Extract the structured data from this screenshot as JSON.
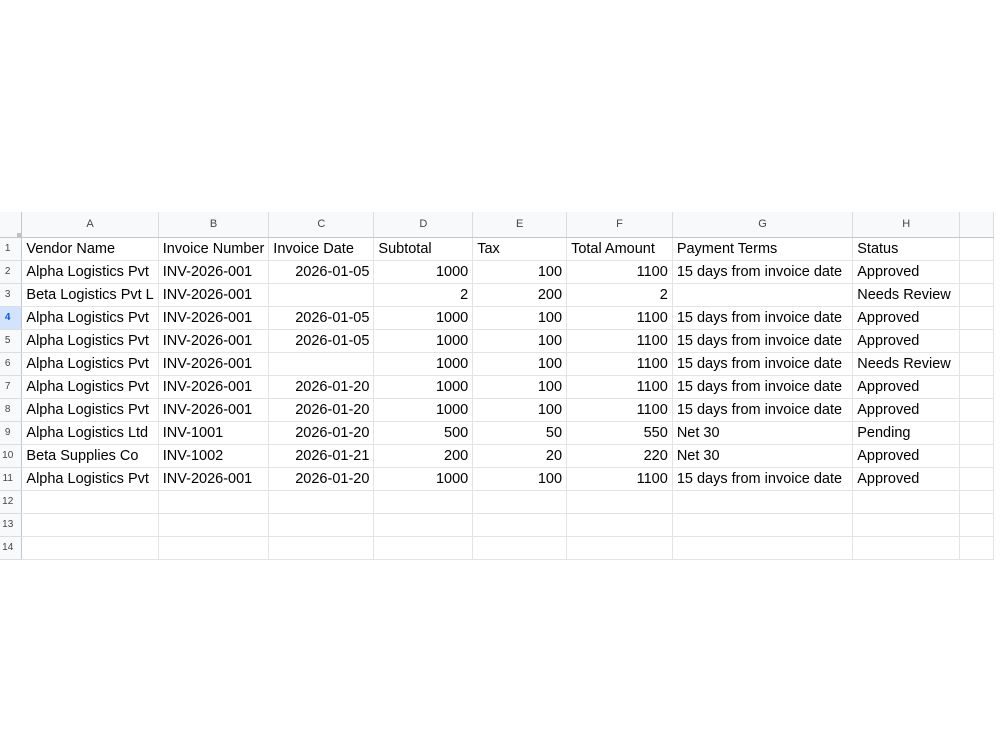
{
  "columns": [
    "A",
    "B",
    "C",
    "D",
    "E",
    "F",
    "G",
    "H",
    ""
  ],
  "header_row": {
    "row": "1",
    "cells": [
      "Vendor Name",
      "Invoice Number",
      "Invoice Date",
      "Subtotal",
      "Tax",
      "Total Amount",
      "Payment Terms",
      "Status",
      ""
    ]
  },
  "rows": [
    {
      "row": "2",
      "cells": [
        "Alpha Logistics Pvt",
        "INV-2026-001",
        "2026-01-05",
        "1000",
        "100",
        "1100",
        "15 days from invoice date",
        "Approved",
        ""
      ]
    },
    {
      "row": "3",
      "cells": [
        "Beta Logistics Pvt L",
        "INV-2026-001",
        "",
        "2",
        "200",
        "2",
        "",
        "Needs Review",
        ""
      ]
    },
    {
      "row": "4",
      "cells": [
        "Alpha Logistics Pvt",
        "INV-2026-001",
        "2026-01-05",
        "1000",
        "100",
        "1100",
        "15 days from invoice date",
        "Approved",
        ""
      ]
    },
    {
      "row": "5",
      "cells": [
        "Alpha Logistics Pvt",
        "INV-2026-001",
        "2026-01-05",
        "1000",
        "100",
        "1100",
        "15 days from invoice date",
        "Approved",
        ""
      ]
    },
    {
      "row": "6",
      "cells": [
        "Alpha Logistics Pvt",
        "INV-2026-001",
        "",
        "1000",
        "100",
        "1100",
        "15 days from invoice date",
        "Needs Review",
        ""
      ]
    },
    {
      "row": "7",
      "cells": [
        "Alpha Logistics Pvt",
        "INV-2026-001",
        "2026-01-20",
        "1000",
        "100",
        "1100",
        "15 days from invoice date",
        "Approved",
        ""
      ]
    },
    {
      "row": "8",
      "cells": [
        "Alpha Logistics Pvt",
        "INV-2026-001",
        "2026-01-20",
        "1000",
        "100",
        "1100",
        "15 days from invoice date",
        "Approved",
        ""
      ]
    },
    {
      "row": "9",
      "cells": [
        "Alpha Logistics Ltd",
        "INV-1001",
        "2026-01-20",
        "500",
        "50",
        "550",
        "Net 30",
        "Pending",
        ""
      ]
    },
    {
      "row": "10",
      "cells": [
        "Beta Supplies Co",
        "INV-1002",
        "2026-01-21",
        "200",
        "20",
        "220",
        "Net 30",
        "Approved",
        ""
      ]
    },
    {
      "row": "11",
      "cells": [
        "Alpha Logistics Pvt",
        "INV-2026-001",
        "2026-01-20",
        "1000",
        "100",
        "1100",
        "15 days from invoice date",
        "Approved",
        ""
      ]
    },
    {
      "row": "12",
      "cells": [
        "",
        "",
        "",
        "",
        "",
        "",
        "",
        "",
        ""
      ]
    },
    {
      "row": "13",
      "cells": [
        "",
        "",
        "",
        "",
        "",
        "",
        "",
        "",
        ""
      ]
    },
    {
      "row": "14",
      "cells": [
        "",
        "",
        "",
        "",
        "",
        "",
        "",
        "",
        ""
      ]
    }
  ],
  "active_row": "4",
  "colors": {
    "header_bg": "#f8f9fa",
    "gridline": "#e2e3e3",
    "active_row_bg": "#d3e3fd",
    "active_row_text": "#0b57d0"
  }
}
